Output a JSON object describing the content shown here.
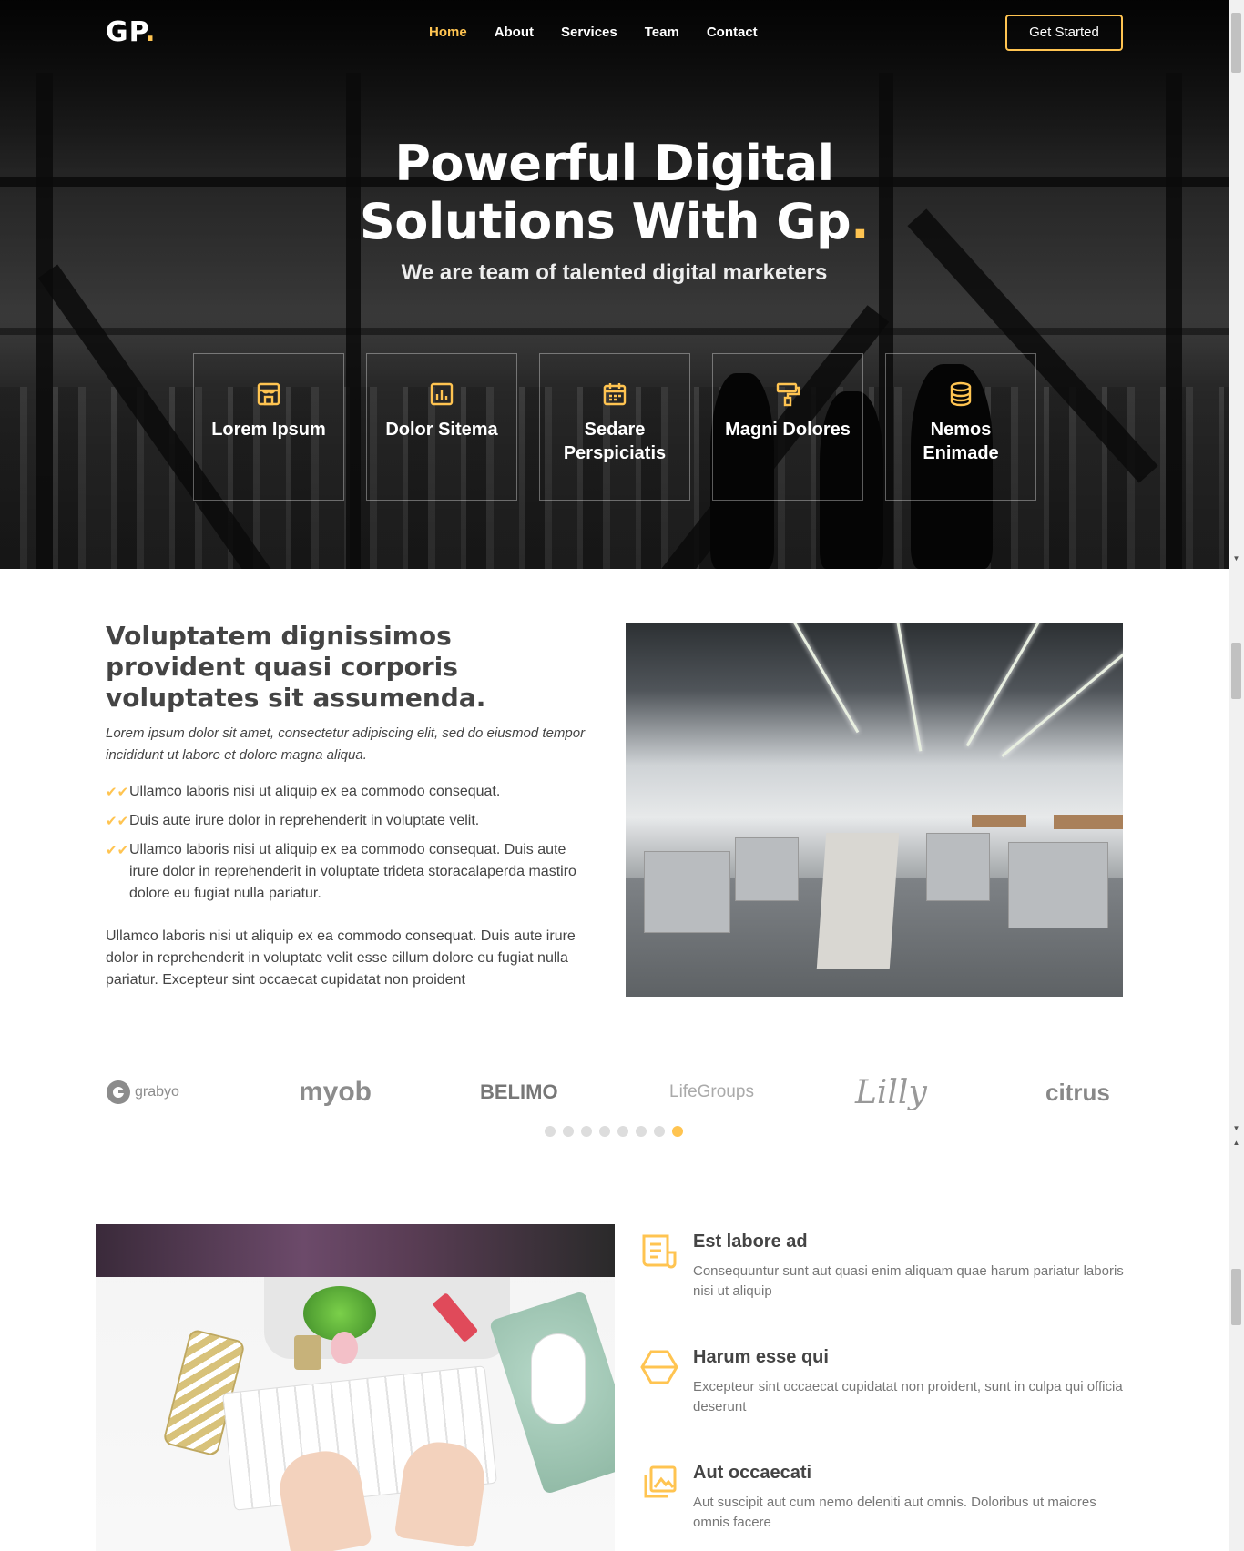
{
  "header": {
    "logo": "GP",
    "logo_dot": ".",
    "nav": [
      "Home",
      "About",
      "Services",
      "Team",
      "Contact"
    ],
    "active_nav": "Home",
    "cta_label": "Get Started"
  },
  "hero": {
    "title_line1": "Powerful Digital",
    "title_line2": "Solutions With Gp",
    "title_dot": ".",
    "subtitle": "We are team of talented digital marketers",
    "boxes": [
      {
        "icon": "store-icon",
        "label": "Lorem Ipsum"
      },
      {
        "icon": "bar-chart-icon",
        "label": "Dolor Sitema"
      },
      {
        "icon": "calendar-icon",
        "label": "Sedare Perspiciatis"
      },
      {
        "icon": "paint-roller-icon",
        "label": "Magni Dolores"
      },
      {
        "icon": "database-icon",
        "label": "Nemos Enimade"
      }
    ]
  },
  "about": {
    "title": "Voluptatem dignissimos provident quasi corporis voluptates sit assumenda.",
    "intro": "Lorem ipsum dolor sit amet, consectetur adipiscing elit, sed do eiusmod tempor incididunt ut labore et dolore magna aliqua.",
    "checks": [
      "Ullamco laboris nisi ut aliquip ex ea commodo consequat.",
      "Duis aute irure dolor in reprehenderit in voluptate velit.",
      "Ullamco laboris nisi ut aliquip ex ea commodo consequat. Duis aute irure dolor in reprehenderit in voluptate trideta storacalaperda mastiro dolore eu fugiat nulla pariatur."
    ],
    "paragraph": "Ullamco laboris nisi ut aliquip ex ea commodo consequat. Duis aute irure dolor in reprehenderit in voluptate velit esse cillum dolore eu fugiat nulla pariatur. Excepteur sint occaecat cupidatat non proident"
  },
  "clients": {
    "logos": [
      "grabyo",
      "myob",
      "BELIMO",
      "LifeGroups",
      "Lilly",
      "citrus"
    ],
    "dot_count": 8,
    "active_dot": 8
  },
  "features": [
    {
      "icon": "receipt-icon",
      "title": "Est labore ad",
      "desc": "Consequuntur sunt aut quasi enim aliquam quae harum pariatur laboris nisi ut aliquip"
    },
    {
      "icon": "cube-icon",
      "title": "Harum esse qui",
      "desc": "Excepteur sint occaecat cupidatat non proident, sunt in culpa qui officia deserunt"
    },
    {
      "icon": "images-icon",
      "title": "Aut occaecati",
      "desc": "Aut suscipit aut cum nemo deleniti aut omnis. Doloribus ut maiores omnis facere"
    }
  ],
  "colors": {
    "accent": "#ffc451",
    "dark": "#151515",
    "text": "#444444"
  }
}
